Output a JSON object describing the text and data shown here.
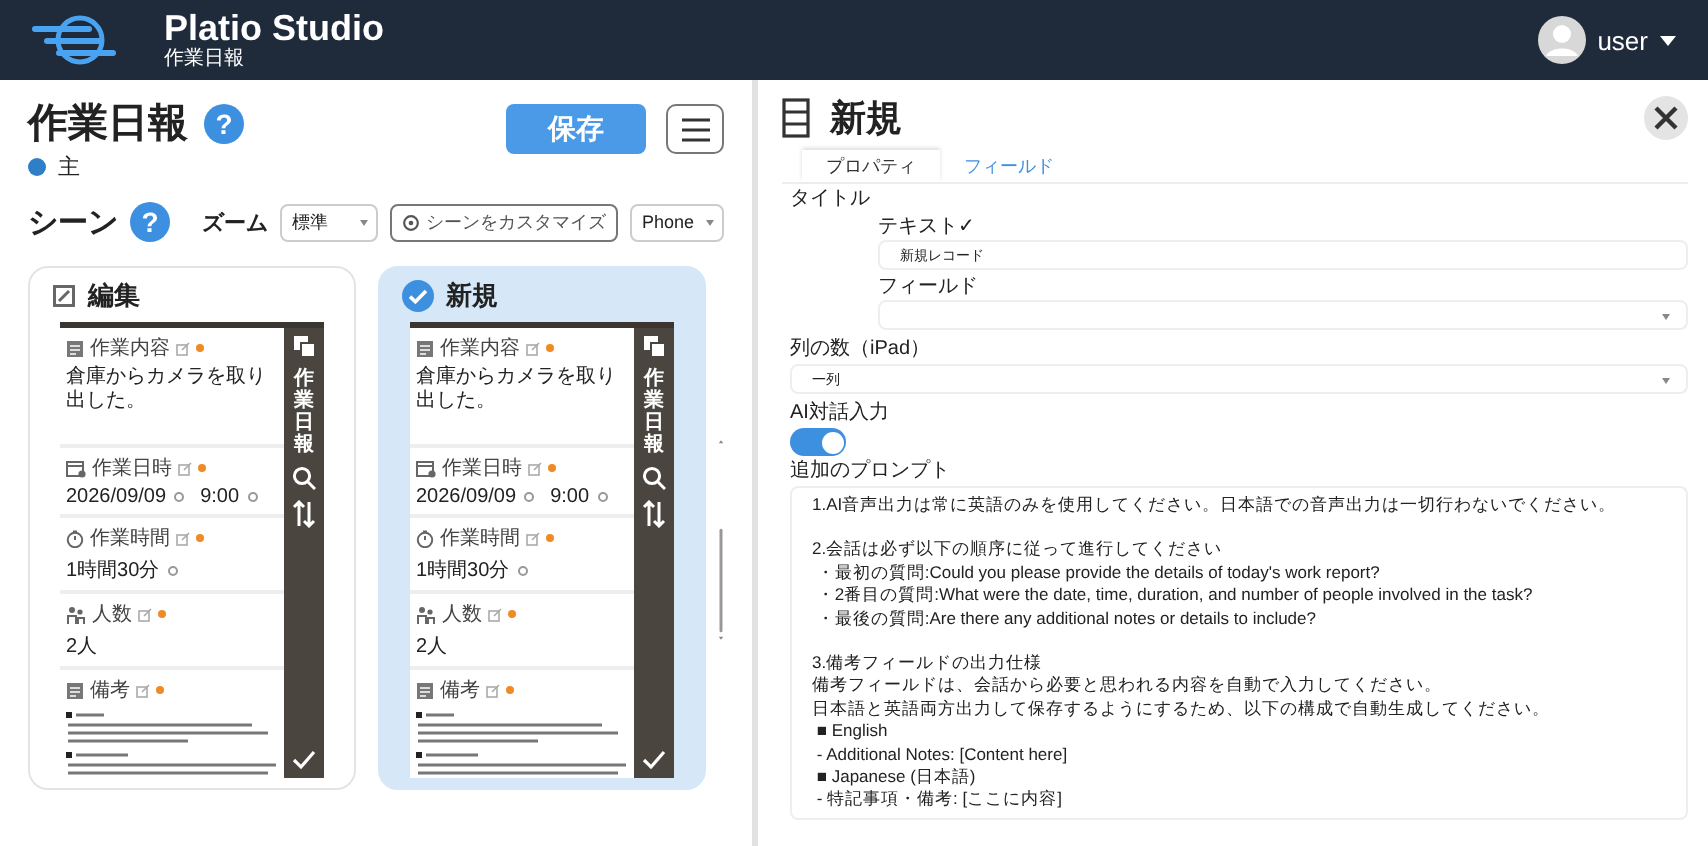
{
  "header": {
    "app_name": "Platio Studio",
    "subtitle": "作業日報",
    "user": "user"
  },
  "app": {
    "title": "作業日報",
    "help": "?",
    "save": "保存",
    "status": {
      "label": "主",
      "color": "#2f7fc8"
    }
  },
  "scenes_bar": {
    "title": "シーン",
    "help": "?",
    "zoom_label": "ズーム",
    "zoom_value": "標準",
    "customize": "シーンをカスタマイズ",
    "device": "Phone"
  },
  "scenes": [
    {
      "name": "編集",
      "selected": false,
      "preview": {
        "sidebar_title": "作業日報",
        "fields": [
          {
            "label": "作業内容",
            "kind": "text",
            "values": [
              "倉庫からカメラを取り出した。"
            ]
          },
          {
            "label": "作業日時",
            "kind": "datetime",
            "values": [
              "2026/09/09",
              "9:00"
            ]
          },
          {
            "label": "作業時間",
            "kind": "duration",
            "values": [
              "1時間30分"
            ]
          },
          {
            "label": "人数",
            "kind": "number",
            "values": [
              "2人"
            ]
          },
          {
            "label": "備考",
            "kind": "notes"
          }
        ]
      }
    },
    {
      "name": "新規",
      "selected": true,
      "preview": {
        "sidebar_title": "作業日報",
        "fields": [
          {
            "label": "作業内容",
            "kind": "text",
            "values": [
              "倉庫からカメラを取り出した。"
            ]
          },
          {
            "label": "作業日時",
            "kind": "datetime",
            "values": [
              "2026/09/09",
              "9:00"
            ]
          },
          {
            "label": "作業時間",
            "kind": "duration",
            "values": [
              "1時間30分"
            ]
          },
          {
            "label": "人数",
            "kind": "number",
            "values": [
              "2人"
            ]
          },
          {
            "label": "備考",
            "kind": "notes"
          }
        ]
      }
    }
  ],
  "panel": {
    "title": "新規",
    "tabs": [
      {
        "label": "プロパティ",
        "selected": true
      },
      {
        "label": "フィールド",
        "selected": false
      }
    ],
    "title_label": "タイトル",
    "text_label": "テキスト✓",
    "text_value": "新規レコード",
    "field_label": "フィールド",
    "columns_label": "列の数（iPad）",
    "columns_value": "一列",
    "ai_label": "AI対話入力",
    "ai_on": true,
    "prompt_label": "追加のプロンプト",
    "prompt": [
      [
        "1.AI音声出力は常に英語のみを使用してください。日本語での音声出力は一切行わないでください。"
      ],
      [
        "2.会話は必ず以下の順序に従って進行してください",
        " ・最初の質問:Could you please provide the details of today's work report?",
        " ・2番目の質問:What were the date, time, duration, and number of people involved in the task?",
        " ・最後の質問:Are there any additional notes or details to include?"
      ],
      [
        "3.備考フィールドの出力仕様",
        "備考フィールドは、会話から必要と思われる内容を自動で入力してください。",
        "日本語と英語両方出力して保存するようにするため、以下の構成で自動生成してください。",
        " ■ English",
        " - Additional Notes: [Content here]",
        " ■ Japanese (日本語)",
        " - 特記事項・備考: [ここに内容]"
      ]
    ]
  }
}
